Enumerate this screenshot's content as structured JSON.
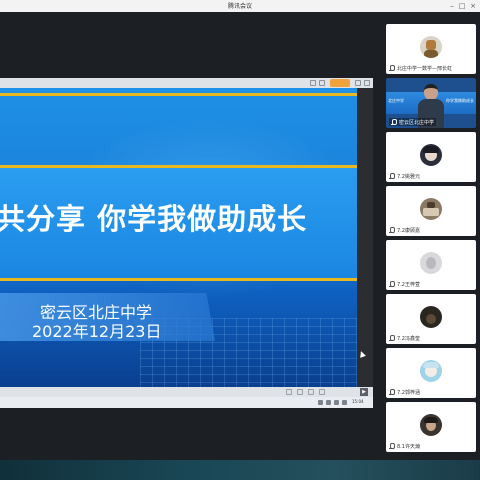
{
  "app": {
    "title": "腾讯会议"
  },
  "slide": {
    "headline": "共分享 你学我做助成长",
    "school": "密云区北庄中学",
    "date": "2022年12月23日"
  },
  "system": {
    "clock": "15:04"
  },
  "participants": [
    {
      "name": "北庄中学一数学—邢长虹",
      "avatar": "avatar-1",
      "kind": "photo"
    },
    {
      "name": "密云区北庄中学",
      "avatar": "video-feed",
      "kind": "video",
      "banner_left": "北庄中学",
      "banner_right": "你学我做助成长"
    },
    {
      "name": "7.2姚雅元",
      "avatar": "avatar-3",
      "kind": "photo"
    },
    {
      "name": "7.2康顾嘉",
      "avatar": "avatar-4",
      "kind": "photo"
    },
    {
      "name": "7.2王梓萱",
      "avatar": "avatar-5",
      "kind": "photo"
    },
    {
      "name": "7.2冯鑫奎",
      "avatar": "avatar-6",
      "kind": "photo"
    },
    {
      "name": "7.2郭梓涵",
      "avatar": "avatar-7",
      "kind": "photo"
    },
    {
      "name": "8.1许天瀚",
      "avatar": "avatar-8",
      "kind": "photo"
    }
  ],
  "colors": {
    "slide_blue": "#1a7fd8",
    "gold_band": "#e8b81f",
    "window_bg": "#1c1f24",
    "accent_badge": "#f2a23a"
  }
}
